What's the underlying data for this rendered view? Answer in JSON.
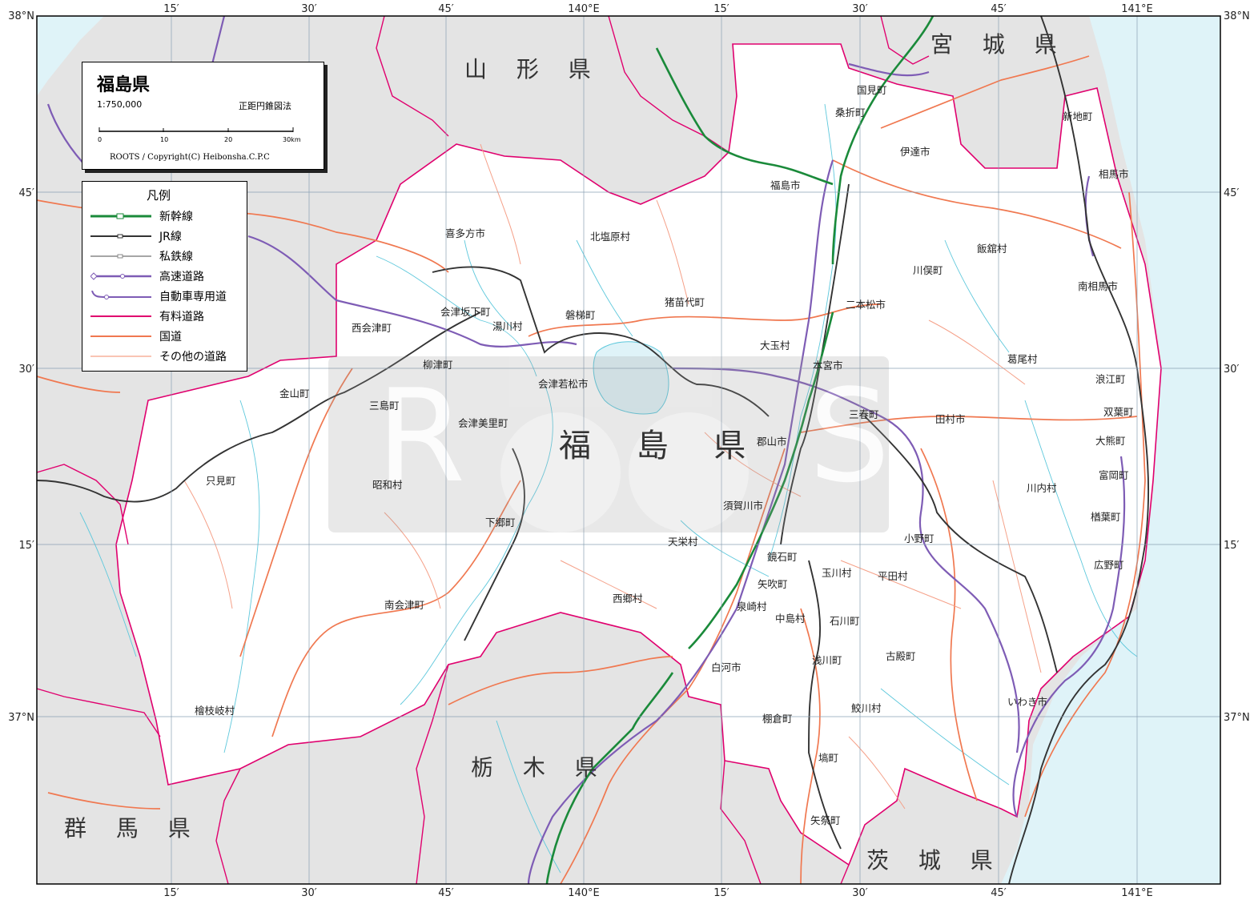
{
  "title": "福島県",
  "scale": "1:750,000",
  "projection": "正距円錐図法",
  "scale_bar": {
    "labels": [
      "0",
      "10",
      "20",
      "30km"
    ]
  },
  "copyright": "ROOTS / Copyright(C) Heibonsha.C.P.C",
  "legend": {
    "title": "凡例",
    "items": [
      {
        "label": "新幹線",
        "color": "#1a8a3a"
      },
      {
        "label": "JR線",
        "color": "#333333"
      },
      {
        "label": "私鉄線",
        "color": "#888888"
      },
      {
        "label": "高速道路",
        "color": "#7e5cb5"
      },
      {
        "label": "自動車専用道",
        "color": "#7e5cb5"
      },
      {
        "label": "有料道路",
        "color": "#e0006e"
      },
      {
        "label": "国道",
        "color": "#f07850"
      },
      {
        "label": "その他の道路",
        "color": "#f5a088"
      }
    ]
  },
  "grid_labels": {
    "top": [
      "15′",
      "30′",
      "45′",
      "140°E",
      "15′",
      "30′",
      "45′",
      "141°E"
    ],
    "bottom": [
      "15′",
      "30′",
      "45′",
      "140°E",
      "15′",
      "30′",
      "45′",
      "141°E"
    ],
    "left": [
      "38°N",
      "45′",
      "30′",
      "15′",
      "37°N"
    ],
    "right": [
      "38°N",
      "45′",
      "30′",
      "15′",
      "37°N"
    ]
  },
  "main_label": "福 島 県",
  "prefectures": [
    {
      "name": "山 形 県"
    },
    {
      "name": "宮 城 県"
    },
    {
      "name": "栃 木 県"
    },
    {
      "name": "群 馬 県"
    },
    {
      "name": "茨 城 県"
    }
  ],
  "places": [
    {
      "name": "国見町"
    },
    {
      "name": "桑折町"
    },
    {
      "name": "伊達市"
    },
    {
      "name": "新地町"
    },
    {
      "name": "相馬市"
    },
    {
      "name": "福島市"
    },
    {
      "name": "喜多方市"
    },
    {
      "name": "北塩原村"
    },
    {
      "name": "飯舘村"
    },
    {
      "name": "川俣町"
    },
    {
      "name": "南相馬市"
    },
    {
      "name": "猪苗代町"
    },
    {
      "name": "二本松市"
    },
    {
      "name": "会津坂下町"
    },
    {
      "name": "磐梯町"
    },
    {
      "name": "西会津町"
    },
    {
      "name": "湯川村"
    },
    {
      "name": "大玉村"
    },
    {
      "name": "葛尾村"
    },
    {
      "name": "柳津町"
    },
    {
      "name": "本宮市"
    },
    {
      "name": "浪江町"
    },
    {
      "name": "会津若松市"
    },
    {
      "name": "金山町"
    },
    {
      "name": "三島町"
    },
    {
      "name": "三春町"
    },
    {
      "name": "田村市"
    },
    {
      "name": "双葉町"
    },
    {
      "name": "会津美里町"
    },
    {
      "name": "郡山市"
    },
    {
      "name": "大熊町"
    },
    {
      "name": "只見町"
    },
    {
      "name": "富岡町"
    },
    {
      "name": "昭和村"
    },
    {
      "name": "川内村"
    },
    {
      "name": "須賀川市"
    },
    {
      "name": "下郷町"
    },
    {
      "name": "楢葉町"
    },
    {
      "name": "小野町"
    },
    {
      "name": "天栄村"
    },
    {
      "name": "鏡石町"
    },
    {
      "name": "広野町"
    },
    {
      "name": "玉川村"
    },
    {
      "name": "平田村"
    },
    {
      "name": "矢吹町"
    },
    {
      "name": "西郷村"
    },
    {
      "name": "泉崎村"
    },
    {
      "name": "南会津町"
    },
    {
      "name": "中島村"
    },
    {
      "name": "石川町"
    },
    {
      "name": "白河市"
    },
    {
      "name": "浅川町"
    },
    {
      "name": "古殿町"
    },
    {
      "name": "いわき市"
    },
    {
      "name": "檜枝岐村"
    },
    {
      "name": "鮫川村"
    },
    {
      "name": "棚倉町"
    },
    {
      "name": "塙町"
    },
    {
      "name": "矢祭町"
    }
  ],
  "colors": {
    "sea": "#dff3f8",
    "other_land": "#e4e4e4",
    "fukushima": "#ffffff",
    "pref_border": "#e0006e",
    "national_road": "#f07850",
    "expressway": "#7e5cb5",
    "shinkansen": "#1a8a3a",
    "jr": "#333333",
    "river": "#5ec8dc",
    "grid": "#8aa0b4"
  }
}
